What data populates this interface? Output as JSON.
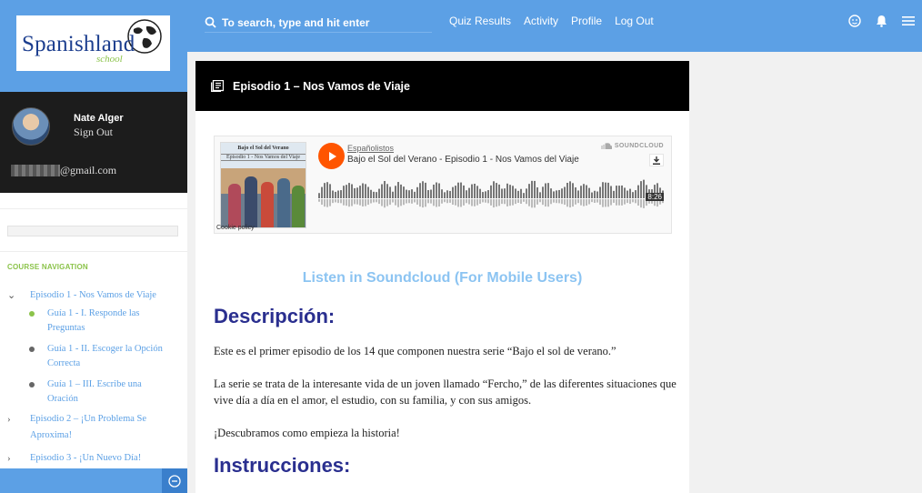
{
  "brand": {
    "logo_text": "Spanishland",
    "logo_sub": "school"
  },
  "user": {
    "name": "Nate Alger",
    "sign_out": "Sign Out",
    "email_suffix": "@gmail.com"
  },
  "search": {
    "placeholder": "To search, type and hit enter"
  },
  "top_nav": [
    {
      "label": "Quiz Results"
    },
    {
      "label": "Activity"
    },
    {
      "label": "Profile"
    },
    {
      "label": "Log Out"
    }
  ],
  "course_nav": {
    "title": "COURSE NAVIGATION",
    "episodes": [
      {
        "label": "Episodio 1 - Nos Vamos de Viaje",
        "expanded": true
      },
      {
        "label": "Episodio 2 – ¡Un Problema Se Aproxima!",
        "expanded": false
      },
      {
        "label": "Episodio 3 - ¡Un Nuevo Día!",
        "expanded": false
      }
    ],
    "guides": [
      {
        "label": "Guía 1 - I. Responde las Preguntas",
        "completed": true
      },
      {
        "label": "Guía 1 - II. Escoger la Opción Correcta",
        "completed": false
      },
      {
        "label": "Guía 1 – III. Escribe una Oración",
        "completed": false
      }
    ]
  },
  "lesson": {
    "title": "Episodio 1 – Nos Vamos de Viaje",
    "soundcloud": {
      "user": "Españolistos",
      "track": "Bajo el Sol del Verano - Episodio 1 - Nos Vamos del Viaje",
      "brand": "SOUNDCLOUD",
      "duration": "8:26",
      "cookie_policy": "Cookie policy",
      "art_title_1": "Bajo el Sol del Verano",
      "art_title_2": "Episodio 1 - Nos Vamos del Viaje"
    },
    "listen_link": "Listen in Soundcloud (For Mobile Users)",
    "description_heading": "Descripción:",
    "paragraphs": [
      "Este es el primer episodio de los 14 que componen  nuestra serie “Bajo el sol de verano.”",
      "La serie se trata de la interesante vida de un joven llamado “Fercho,” de las diferentes situaciones que vive día a día en el amor, el estudio, con su familia, y con sus amigos.",
      "¡Descubramos como empieza la historia!"
    ],
    "instructions_heading": "Instrucciones:"
  },
  "colors": {
    "accent": "#5ca0e5",
    "heading": "#2a2f8f",
    "green": "#8bc34a",
    "soundcloud": "#ff5500"
  }
}
